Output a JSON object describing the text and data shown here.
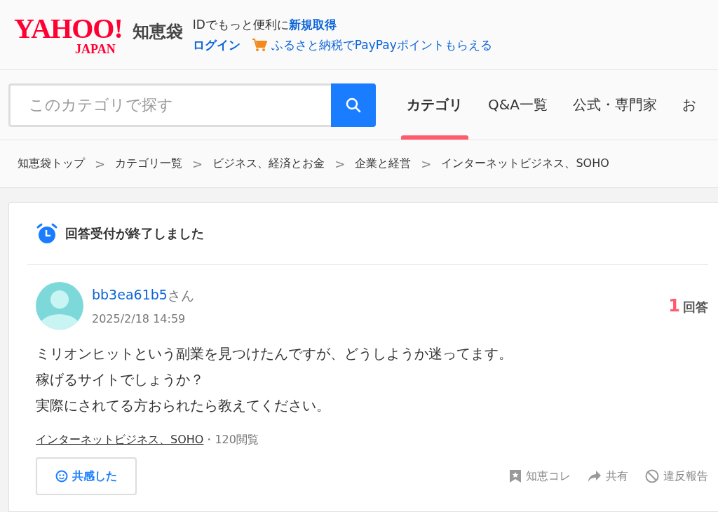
{
  "header": {
    "logo": {
      "brand": "YAHOO!",
      "region": "JAPAN",
      "service": "知恵袋"
    },
    "promo_line": {
      "text": "IDでもっと便利に",
      "link": "新規取得"
    },
    "login": "ログイン",
    "furusato_link": "ふるさと納税でPayPayポイントもらえる"
  },
  "search": {
    "placeholder": "このカテゴリで探す"
  },
  "nav_tabs": [
    {
      "label": "カテゴリ",
      "selected": true
    },
    {
      "label": "Q&A一覧",
      "selected": false
    },
    {
      "label": "公式・専門家",
      "selected": false
    },
    {
      "label": "お",
      "selected": false
    }
  ],
  "breadcrumb": [
    "知恵袋トップ",
    "カテゴリ一覧",
    "ビジネス、経済とお金",
    "企業と経営",
    "インターネットビジネス、SOHO"
  ],
  "breadcrumb_separator": ">",
  "question": {
    "status": "回答受付が終了しました",
    "user": "bb3ea61b5",
    "honorific": "さん",
    "date": "2025/2/18 14:59",
    "answer_count": "1",
    "answer_label": "回答",
    "body": [
      "ミリオンヒットという副業を見つけたんですが、どうしようか迷ってます。",
      "稼げるサイトでしょうか？",
      "実際にされてる方おられたら教えてください。"
    ],
    "category": "インターネットビジネス、SOHO",
    "views": "・120閲覧",
    "empathy_button": "共感した",
    "actions": [
      {
        "kind": "bookmark",
        "label": "知恵コレ"
      },
      {
        "kind": "share",
        "label": "共有"
      },
      {
        "kind": "report",
        "label": "違反報告"
      }
    ]
  }
}
